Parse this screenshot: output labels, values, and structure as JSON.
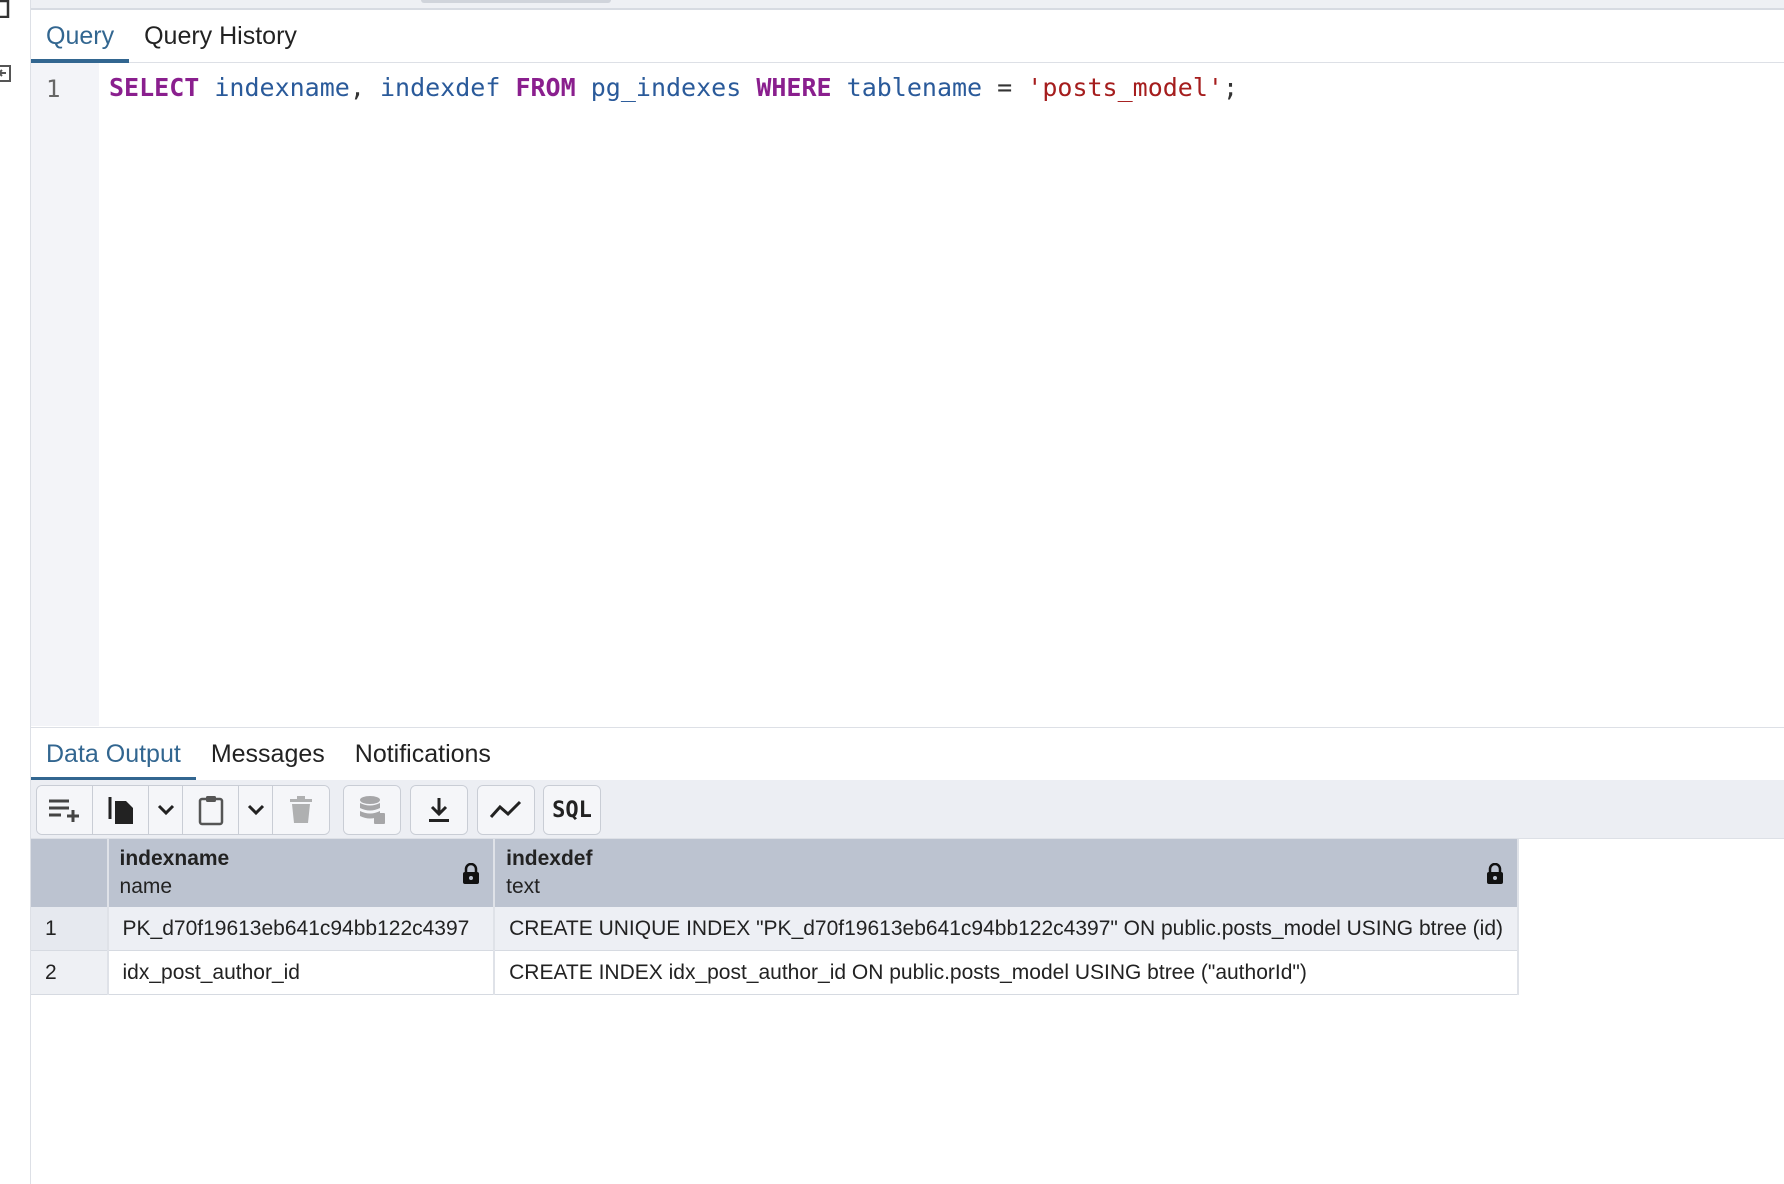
{
  "query_tabs": [
    {
      "label": "Query",
      "active": true
    },
    {
      "label": "Query History",
      "active": false
    }
  ],
  "editor": {
    "line_number": "1",
    "tokens": {
      "select": "SELECT",
      "col1": "indexname",
      "comma": ",",
      "col2": "indexdef",
      "from": "FROM",
      "table": "pg_indexes",
      "where": "WHERE",
      "col3": "tablename",
      "eq": "=",
      "value": "'posts_model'",
      "semi": ";"
    }
  },
  "output_tabs": [
    {
      "label": "Data Output",
      "active": true
    },
    {
      "label": "Messages",
      "active": false
    },
    {
      "label": "Notifications",
      "active": false
    }
  ],
  "toolbar": {
    "sql_label": "SQL",
    "icons": [
      "add-row-icon",
      "copy-icon",
      "chevron-down-icon",
      "paste-icon",
      "chevron-down-icon",
      "delete-icon",
      "save-data-icon",
      "download-icon",
      "graph-icon",
      "sql-icon"
    ]
  },
  "grid": {
    "columns": [
      {
        "name": "indexname",
        "type": "name"
      },
      {
        "name": "indexdef",
        "type": "text"
      }
    ],
    "rows": [
      {
        "num": "1",
        "indexname": "PK_d70f19613eb641c94bb122c4397",
        "indexdef": "CREATE UNIQUE INDEX \"PK_d70f19613eb641c94bb122c4397\" ON public.posts_model USING btree (id)"
      },
      {
        "num": "2",
        "indexname": "idx_post_author_id",
        "indexdef": "CREATE INDEX idx_post_author_id ON public.posts_model USING btree (\"authorId\")"
      }
    ]
  },
  "colors": {
    "accent": "#326690",
    "keyword": "#8a1f8e",
    "identifier": "#2a5a9a",
    "string": "#a51d1d",
    "header_bg": "#bcc3d0"
  }
}
